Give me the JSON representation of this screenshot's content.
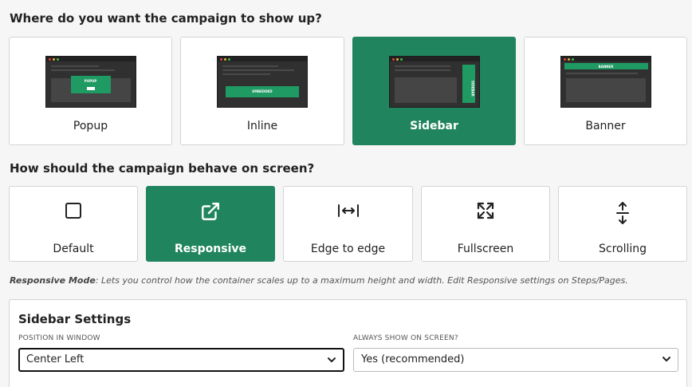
{
  "q1": "Where do you want the campaign to show up?",
  "q2": "How should the campaign behave on screen?",
  "placement": [
    {
      "label": "Popup",
      "thumb_text": "POPUP",
      "selected": false
    },
    {
      "label": "Inline",
      "thumb_text": "EMBEDDED",
      "selected": false
    },
    {
      "label": "Sidebar",
      "thumb_text": "SIDEBAR",
      "selected": true
    },
    {
      "label": "Banner",
      "thumb_text": "BANNER",
      "selected": false
    }
  ],
  "behavior": [
    {
      "label": "Default",
      "icon": "square-icon",
      "selected": false
    },
    {
      "label": "Responsive",
      "icon": "external-link-icon",
      "selected": true
    },
    {
      "label": "Edge to edge",
      "icon": "edge-to-edge-icon",
      "selected": false
    },
    {
      "label": "Fullscreen",
      "icon": "expand-icon",
      "selected": false
    },
    {
      "label": "Scrolling",
      "icon": "scroll-vertical-icon",
      "selected": false
    }
  ],
  "note": {
    "title": "Responsive Mode",
    "text": ": Lets you control how the container scales up to a maximum height and width. Edit Responsive settings on Steps/Pages."
  },
  "settings": {
    "title": "Sidebar Settings",
    "position_label": "POSITION IN WINDOW",
    "position_value": "Center Left",
    "always_label": "ALWAYS SHOW ON SCREEN?",
    "always_value": "Yes (recommended)"
  },
  "colors": {
    "accent": "#20855e",
    "thumb_bg": "#303030",
    "thumb_green": "#1f9a63"
  }
}
